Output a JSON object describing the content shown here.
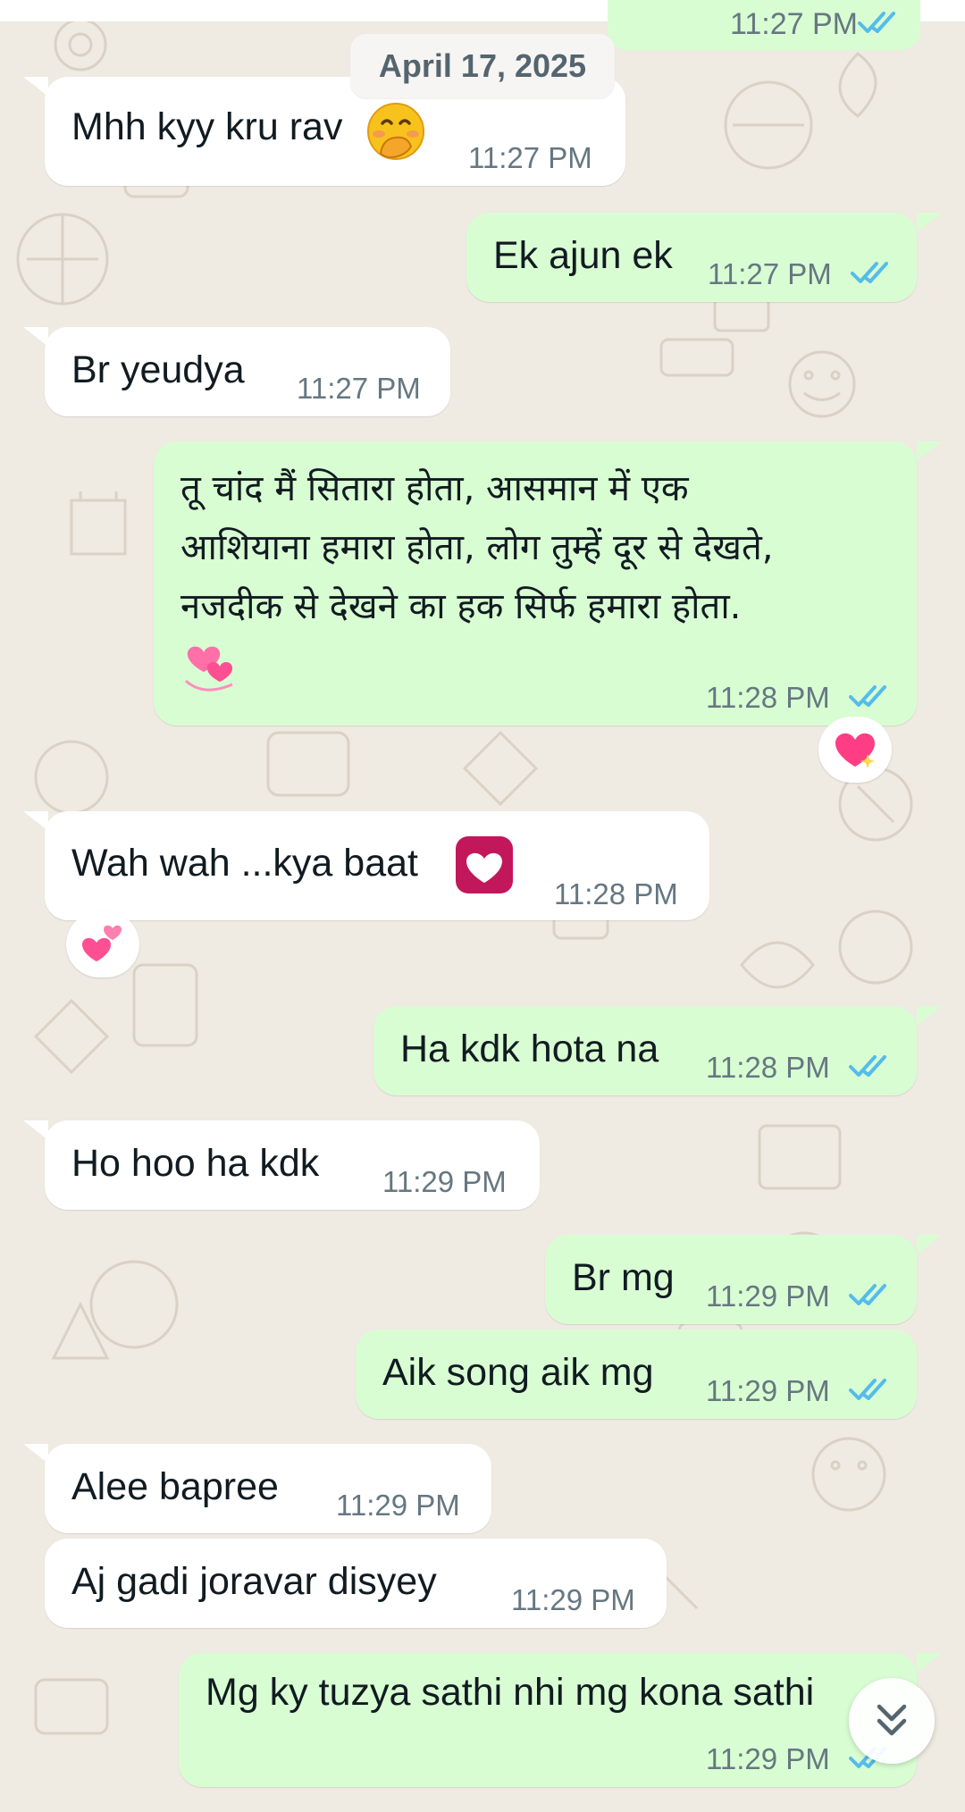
{
  "chat": {
    "date_separator": "April 17, 2025",
    "partial_top_time": "11:27 PM",
    "messages": [
      {
        "text": "Mhh kyy kru rav",
        "time": "11:27 PM",
        "direction": "incoming",
        "emoji": "face-with-hand-over-mouth"
      },
      {
        "text": "Ek ajun ek",
        "time": "11:27 PM",
        "direction": "outgoing",
        "status": "read"
      },
      {
        "text": "Br yeudya",
        "time": "11:27 PM",
        "direction": "incoming"
      },
      {
        "lines": [
          "तू चांद मैं सितारा होता, आसमान में एक",
          "आशियाना हमारा होता, लोग तुम्हें दूर से देखते,",
          "नजदीक से देखने का हक सिर्फ हमारा होता."
        ],
        "time": "11:28 PM",
        "direction": "outgoing",
        "status": "read",
        "emoji": "revolving-hearts",
        "reaction": "sparkling-heart"
      },
      {
        "text": "Wah wah ...kya baat",
        "time": "11:28 PM",
        "direction": "incoming",
        "emoji": "heart-decoration",
        "reaction": "two-hearts"
      },
      {
        "text": "Ha kdk hota na",
        "time": "11:28 PM",
        "direction": "outgoing",
        "status": "read"
      },
      {
        "text": "Ho hoo ha kdk",
        "time": "11:29 PM",
        "direction": "incoming"
      },
      {
        "text": "Br mg",
        "time": "11:29 PM",
        "direction": "outgoing",
        "status": "read"
      },
      {
        "text": "Aik song aik mg",
        "time": "11:29 PM",
        "direction": "outgoing",
        "status": "read"
      },
      {
        "text": "Alee bapree",
        "time": "11:29 PM",
        "direction": "incoming"
      },
      {
        "text": "Aj gadi joravar disyey",
        "time": "11:29 PM",
        "direction": "incoming"
      },
      {
        "text": "Mg ky tuzya sathi nhi mg kona sathi",
        "time": "11:29 PM",
        "direction": "outgoing",
        "status": "read"
      }
    ]
  },
  "colors": {
    "wallpaper": "#efeae2",
    "incoming_bubble": "#ffffff",
    "outgoing_bubble": "#d9fdd3",
    "read_tick": "#53bdeb",
    "timestamp": "#667781"
  },
  "icons": {
    "read_receipt": "double-check-icon",
    "scroll_down": "double-chevron-down-icon"
  }
}
